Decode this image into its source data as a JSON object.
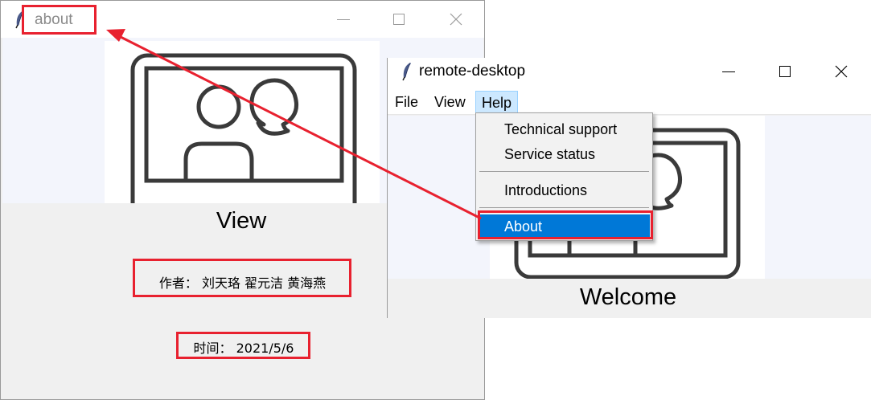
{
  "about_window": {
    "title": "about",
    "image_caption": "View",
    "author_line": "作者： 刘天珞 翟元洁 黄海燕",
    "date_line": "时间： 2021/5/6"
  },
  "remote_window": {
    "title": "remote-desktop",
    "menu": [
      "File",
      "View",
      "Help"
    ],
    "caption": "Welcome"
  },
  "help_menu": {
    "items": [
      "Technical support",
      "Service status",
      "Introductions",
      "About"
    ],
    "selected": "About"
  },
  "annotation": {
    "color": "#e8212f",
    "accent_select": "#0078d7"
  },
  "icons": {
    "app": "feather-icon",
    "minimize": "minimize-icon",
    "maximize": "maximize-icon",
    "close": "close-icon",
    "illustration": "video-chat-illustration"
  }
}
